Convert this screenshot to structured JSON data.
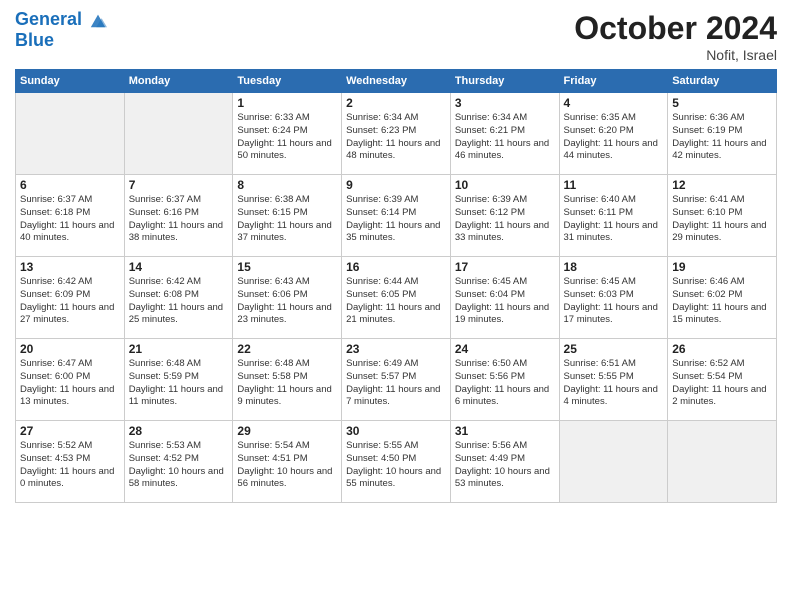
{
  "header": {
    "logo_line1": "General",
    "logo_line2": "Blue",
    "month_title": "October 2024",
    "location": "Nofit, Israel"
  },
  "weekdays": [
    "Sunday",
    "Monday",
    "Tuesday",
    "Wednesday",
    "Thursday",
    "Friday",
    "Saturday"
  ],
  "weeks": [
    [
      {
        "day": "",
        "empty": true
      },
      {
        "day": "",
        "empty": true
      },
      {
        "day": "1",
        "sunrise": "Sunrise: 6:33 AM",
        "sunset": "Sunset: 6:24 PM",
        "daylight": "Daylight: 11 hours and 50 minutes."
      },
      {
        "day": "2",
        "sunrise": "Sunrise: 6:34 AM",
        "sunset": "Sunset: 6:23 PM",
        "daylight": "Daylight: 11 hours and 48 minutes."
      },
      {
        "day": "3",
        "sunrise": "Sunrise: 6:34 AM",
        "sunset": "Sunset: 6:21 PM",
        "daylight": "Daylight: 11 hours and 46 minutes."
      },
      {
        "day": "4",
        "sunrise": "Sunrise: 6:35 AM",
        "sunset": "Sunset: 6:20 PM",
        "daylight": "Daylight: 11 hours and 44 minutes."
      },
      {
        "day": "5",
        "sunrise": "Sunrise: 6:36 AM",
        "sunset": "Sunset: 6:19 PM",
        "daylight": "Daylight: 11 hours and 42 minutes."
      }
    ],
    [
      {
        "day": "6",
        "sunrise": "Sunrise: 6:37 AM",
        "sunset": "Sunset: 6:18 PM",
        "daylight": "Daylight: 11 hours and 40 minutes."
      },
      {
        "day": "7",
        "sunrise": "Sunrise: 6:37 AM",
        "sunset": "Sunset: 6:16 PM",
        "daylight": "Daylight: 11 hours and 38 minutes."
      },
      {
        "day": "8",
        "sunrise": "Sunrise: 6:38 AM",
        "sunset": "Sunset: 6:15 PM",
        "daylight": "Daylight: 11 hours and 37 minutes."
      },
      {
        "day": "9",
        "sunrise": "Sunrise: 6:39 AM",
        "sunset": "Sunset: 6:14 PM",
        "daylight": "Daylight: 11 hours and 35 minutes."
      },
      {
        "day": "10",
        "sunrise": "Sunrise: 6:39 AM",
        "sunset": "Sunset: 6:12 PM",
        "daylight": "Daylight: 11 hours and 33 minutes."
      },
      {
        "day": "11",
        "sunrise": "Sunrise: 6:40 AM",
        "sunset": "Sunset: 6:11 PM",
        "daylight": "Daylight: 11 hours and 31 minutes."
      },
      {
        "day": "12",
        "sunrise": "Sunrise: 6:41 AM",
        "sunset": "Sunset: 6:10 PM",
        "daylight": "Daylight: 11 hours and 29 minutes."
      }
    ],
    [
      {
        "day": "13",
        "sunrise": "Sunrise: 6:42 AM",
        "sunset": "Sunset: 6:09 PM",
        "daylight": "Daylight: 11 hours and 27 minutes."
      },
      {
        "day": "14",
        "sunrise": "Sunrise: 6:42 AM",
        "sunset": "Sunset: 6:08 PM",
        "daylight": "Daylight: 11 hours and 25 minutes."
      },
      {
        "day": "15",
        "sunrise": "Sunrise: 6:43 AM",
        "sunset": "Sunset: 6:06 PM",
        "daylight": "Daylight: 11 hours and 23 minutes."
      },
      {
        "day": "16",
        "sunrise": "Sunrise: 6:44 AM",
        "sunset": "Sunset: 6:05 PM",
        "daylight": "Daylight: 11 hours and 21 minutes."
      },
      {
        "day": "17",
        "sunrise": "Sunrise: 6:45 AM",
        "sunset": "Sunset: 6:04 PM",
        "daylight": "Daylight: 11 hours and 19 minutes."
      },
      {
        "day": "18",
        "sunrise": "Sunrise: 6:45 AM",
        "sunset": "Sunset: 6:03 PM",
        "daylight": "Daylight: 11 hours and 17 minutes."
      },
      {
        "day": "19",
        "sunrise": "Sunrise: 6:46 AM",
        "sunset": "Sunset: 6:02 PM",
        "daylight": "Daylight: 11 hours and 15 minutes."
      }
    ],
    [
      {
        "day": "20",
        "sunrise": "Sunrise: 6:47 AM",
        "sunset": "Sunset: 6:00 PM",
        "daylight": "Daylight: 11 hours and 13 minutes."
      },
      {
        "day": "21",
        "sunrise": "Sunrise: 6:48 AM",
        "sunset": "Sunset: 5:59 PM",
        "daylight": "Daylight: 11 hours and 11 minutes."
      },
      {
        "day": "22",
        "sunrise": "Sunrise: 6:48 AM",
        "sunset": "Sunset: 5:58 PM",
        "daylight": "Daylight: 11 hours and 9 minutes."
      },
      {
        "day": "23",
        "sunrise": "Sunrise: 6:49 AM",
        "sunset": "Sunset: 5:57 PM",
        "daylight": "Daylight: 11 hours and 7 minutes."
      },
      {
        "day": "24",
        "sunrise": "Sunrise: 6:50 AM",
        "sunset": "Sunset: 5:56 PM",
        "daylight": "Daylight: 11 hours and 6 minutes."
      },
      {
        "day": "25",
        "sunrise": "Sunrise: 6:51 AM",
        "sunset": "Sunset: 5:55 PM",
        "daylight": "Daylight: 11 hours and 4 minutes."
      },
      {
        "day": "26",
        "sunrise": "Sunrise: 6:52 AM",
        "sunset": "Sunset: 5:54 PM",
        "daylight": "Daylight: 11 hours and 2 minutes."
      }
    ],
    [
      {
        "day": "27",
        "sunrise": "Sunrise: 5:52 AM",
        "sunset": "Sunset: 4:53 PM",
        "daylight": "Daylight: 11 hours and 0 minutes."
      },
      {
        "day": "28",
        "sunrise": "Sunrise: 5:53 AM",
        "sunset": "Sunset: 4:52 PM",
        "daylight": "Daylight: 10 hours and 58 minutes."
      },
      {
        "day": "29",
        "sunrise": "Sunrise: 5:54 AM",
        "sunset": "Sunset: 4:51 PM",
        "daylight": "Daylight: 10 hours and 56 minutes."
      },
      {
        "day": "30",
        "sunrise": "Sunrise: 5:55 AM",
        "sunset": "Sunset: 4:50 PM",
        "daylight": "Daylight: 10 hours and 55 minutes."
      },
      {
        "day": "31",
        "sunrise": "Sunrise: 5:56 AM",
        "sunset": "Sunset: 4:49 PM",
        "daylight": "Daylight: 10 hours and 53 minutes."
      },
      {
        "day": "",
        "empty": true
      },
      {
        "day": "",
        "empty": true
      }
    ]
  ]
}
